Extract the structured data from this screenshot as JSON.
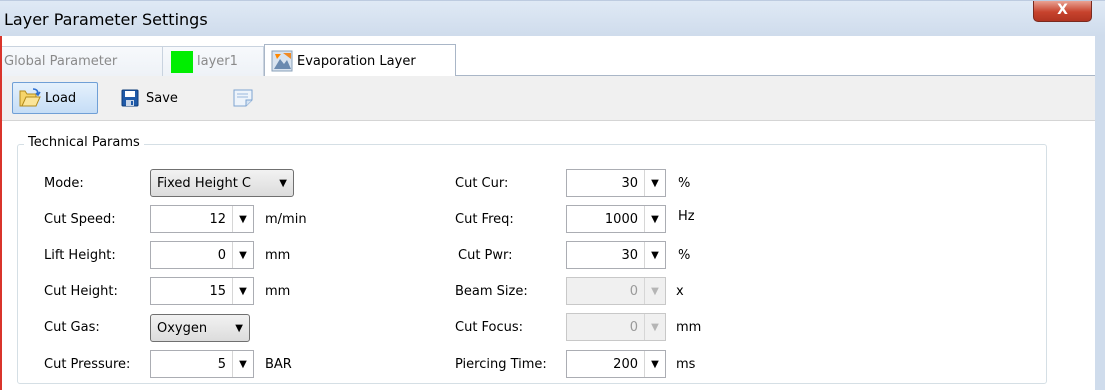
{
  "window": {
    "title": "Layer Parameter Settings",
    "close_glyph": "X"
  },
  "tabs": [
    {
      "label": "Global Parameter",
      "active": false
    },
    {
      "label": "layer1",
      "active": false,
      "swatch_color": "#00ee00"
    },
    {
      "label": "Evaporation Layer",
      "active": true,
      "icon": "evaporation-layer-icon"
    }
  ],
  "toolbar": {
    "load_label": "Load",
    "save_label": "Save"
  },
  "group": {
    "title": "Technical Params"
  },
  "left_fields": {
    "mode": {
      "label": "Mode:",
      "value": "Fixed Height C"
    },
    "cut_speed": {
      "label": "Cut Speed:",
      "value": "12",
      "unit": "m/min"
    },
    "lift_height": {
      "label": "Lift Height:",
      "value": "0",
      "unit": "mm"
    },
    "cut_height": {
      "label": "Cut Height:",
      "value": "15",
      "unit": "mm"
    },
    "cut_gas": {
      "label": "Cut Gas:",
      "value": "Oxygen"
    },
    "cut_pressure": {
      "label": "Cut Pressure:",
      "value": "5",
      "unit": "BAR"
    }
  },
  "right_fields": {
    "cut_cur": {
      "label": "Cut Cur:",
      "value": "30",
      "unit": "%"
    },
    "cut_freq": {
      "label": "Cut Freq:",
      "value": "1000",
      "unit": "Hz"
    },
    "cut_pwr": {
      "label": "Cut Pwr:",
      "value": "30",
      "unit": "%"
    },
    "beam_size": {
      "label": "Beam Size:",
      "value": "0",
      "unit": "x",
      "disabled": true
    },
    "cut_focus": {
      "label": "Cut Focus:",
      "value": "0",
      "unit": "mm",
      "disabled": true
    },
    "piercing_time": {
      "label": "Piercing Time:",
      "value": "200",
      "unit": "ms"
    }
  },
  "colors": {
    "close_button": "#c7432d",
    "window_border": "#d9342b",
    "title_bar": "#dfe9f5"
  }
}
